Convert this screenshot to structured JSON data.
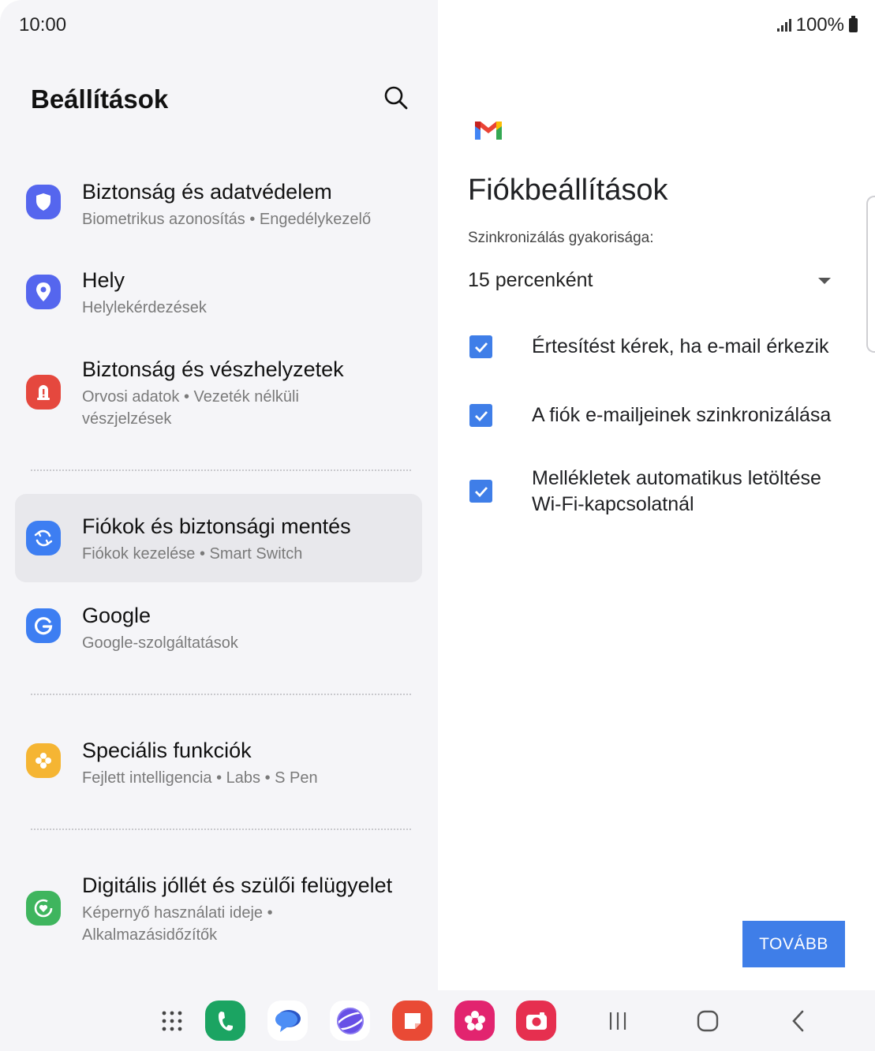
{
  "status_bar": {
    "time": "10:00",
    "battery": "100%"
  },
  "settings": {
    "title": "Beállítások",
    "items": [
      {
        "title": "Biztonság és adatvédelem",
        "subtitle": "Biometrikus azonosítás  •  Engedélykezelő",
        "icon": "shield-icon",
        "color": "#5566ee"
      },
      {
        "title": "Hely",
        "subtitle": "Helylekérdezések",
        "icon": "location-pin-icon",
        "color": "#5566ee"
      },
      {
        "title": "Biztonság és vészhelyzetek",
        "subtitle": "Orvosi adatok  •  Vezeték nélküli vészjelzések",
        "icon": "alert-icon",
        "color": "#e5483e"
      },
      {
        "title": "Fiókok és biztonsági mentés",
        "subtitle": "Fiókok kezelése  •  Smart Switch",
        "icon": "sync-icon",
        "color": "#3d7ef2"
      },
      {
        "title": "Google",
        "subtitle": "Google-szolgáltatások",
        "icon": "google-icon",
        "color": "#3d7ef2"
      },
      {
        "title": "Speciális funkciók",
        "subtitle": "Fejlett intelligencia  •  Labs  •  S Pen",
        "icon": "advanced-features-icon",
        "color": "#f5b533"
      },
      {
        "title": "Digitális jóllét és szülői felügyelet",
        "subtitle": "Képernyő használati ideje  •  Alkalmazásidőzítők",
        "icon": "wellbeing-icon",
        "color": "#3fb55e"
      }
    ]
  },
  "account_settings": {
    "title": "Fiókbeállítások",
    "sync_label": "Szinkronizálás gyakorisága:",
    "sync_value": "15 percenként",
    "options": [
      {
        "label": "Értesítést kérek, ha e-mail érkezik",
        "checked": true
      },
      {
        "label": "A fiók e-mailjeinek szinkronizálása",
        "checked": true
      },
      {
        "label": "Mellékletek automatikus letöltése Wi-Fi-kapcsolatnál",
        "checked": true
      }
    ],
    "next_button": "TOVÁBB"
  },
  "taskbar": {
    "apps": [
      "apps-grid-icon",
      "phone-icon",
      "messages-icon",
      "internet-icon",
      "notes-icon",
      "gallery-icon",
      "camera-icon"
    ],
    "nav": [
      "recents-icon",
      "home-icon",
      "back-icon"
    ]
  },
  "colors": {
    "accent": "#3f7ee8",
    "left_bg": "#f5f5f8",
    "selected_bg": "#e8e8ec"
  }
}
